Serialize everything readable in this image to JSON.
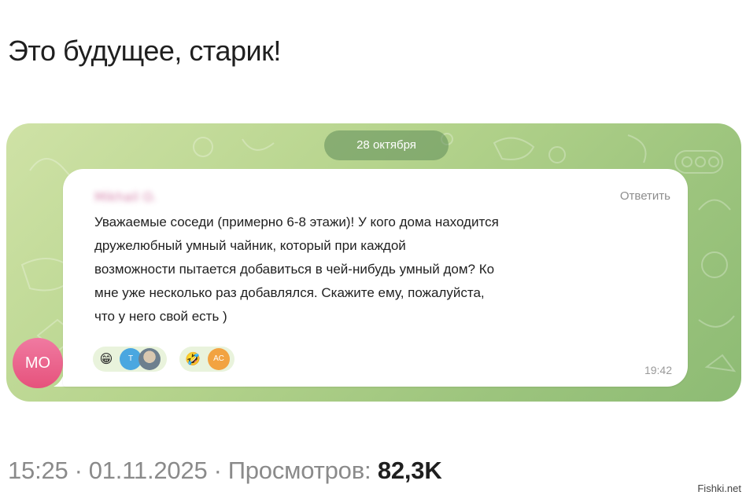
{
  "post": {
    "title": "Это будущее, старик!",
    "time": "15:25",
    "date": "01.11.2025",
    "views_label": "Просмотров:",
    "views_count": "82,3K"
  },
  "chat": {
    "date_pill": "28 октября",
    "avatar_initials": "МО",
    "message": {
      "sender_name_blurred": "Mikhail O.",
      "reply_label": "Ответить",
      "lines": [
        "Уважаемые соседи (примерно 6-8 этажи)! У кого дома находится",
        "дружелюбный умный чайник, который при каждой",
        "возможности пытается добавиться в чей-нибудь умный дом? Ко",
        "мне уже несколько раз добавлялся. Скажите ему, пожалуйста,",
        "что у него свой есть )"
      ],
      "time": "19:42",
      "reactions": [
        {
          "emoji": "😁",
          "avatars": [
            "Т",
            "photo"
          ]
        },
        {
          "emoji": "🤣",
          "avatars": [
            "АС"
          ]
        }
      ]
    }
  },
  "watermark": "Fishki.net",
  "colors": {
    "chat_bg": "#b6d48d",
    "date_pill": "#6a9a63",
    "avatar": "#e6527c",
    "reaction_bg": "#e9f3dc",
    "avatar_t": "#4aa7e0",
    "avatar_ac": "#f2a341"
  }
}
